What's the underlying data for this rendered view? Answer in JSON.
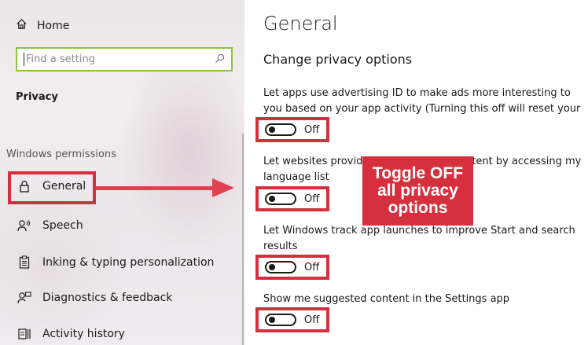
{
  "sidebar": {
    "home_label": "Home",
    "search_placeholder": "Find a setting",
    "section_title": "Privacy",
    "group_label": "Windows permissions",
    "items": [
      {
        "label": "General",
        "icon": "lock-icon"
      },
      {
        "label": "Speech",
        "icon": "speech-icon"
      },
      {
        "label": "Inking & typing personalization",
        "icon": "inking-icon"
      },
      {
        "label": "Diagnostics & feedback",
        "icon": "diagnostics-icon"
      },
      {
        "label": "Activity history",
        "icon": "activity-history-icon"
      }
    ]
  },
  "main": {
    "title": "General",
    "subtitle": "Change privacy options",
    "options": [
      {
        "description": "Let apps use advertising ID to make ads more interesting to you based on your app activity (Turning this off will reset your ID.)",
        "state": "Off"
      },
      {
        "description": "Let websites provide locally relevant content by accessing my language list",
        "state": "Off"
      },
      {
        "description": "Let Windows track app launches to improve Start and search results",
        "state": "Off"
      },
      {
        "description": "Show me suggested content in the Settings app",
        "state": "Off"
      }
    ]
  },
  "annotation": {
    "callout_lines": [
      "Toggle OFF",
      "all privacy",
      "options"
    ],
    "highlight_color": "#d32f3f",
    "callout_color": "#d6303f"
  }
}
